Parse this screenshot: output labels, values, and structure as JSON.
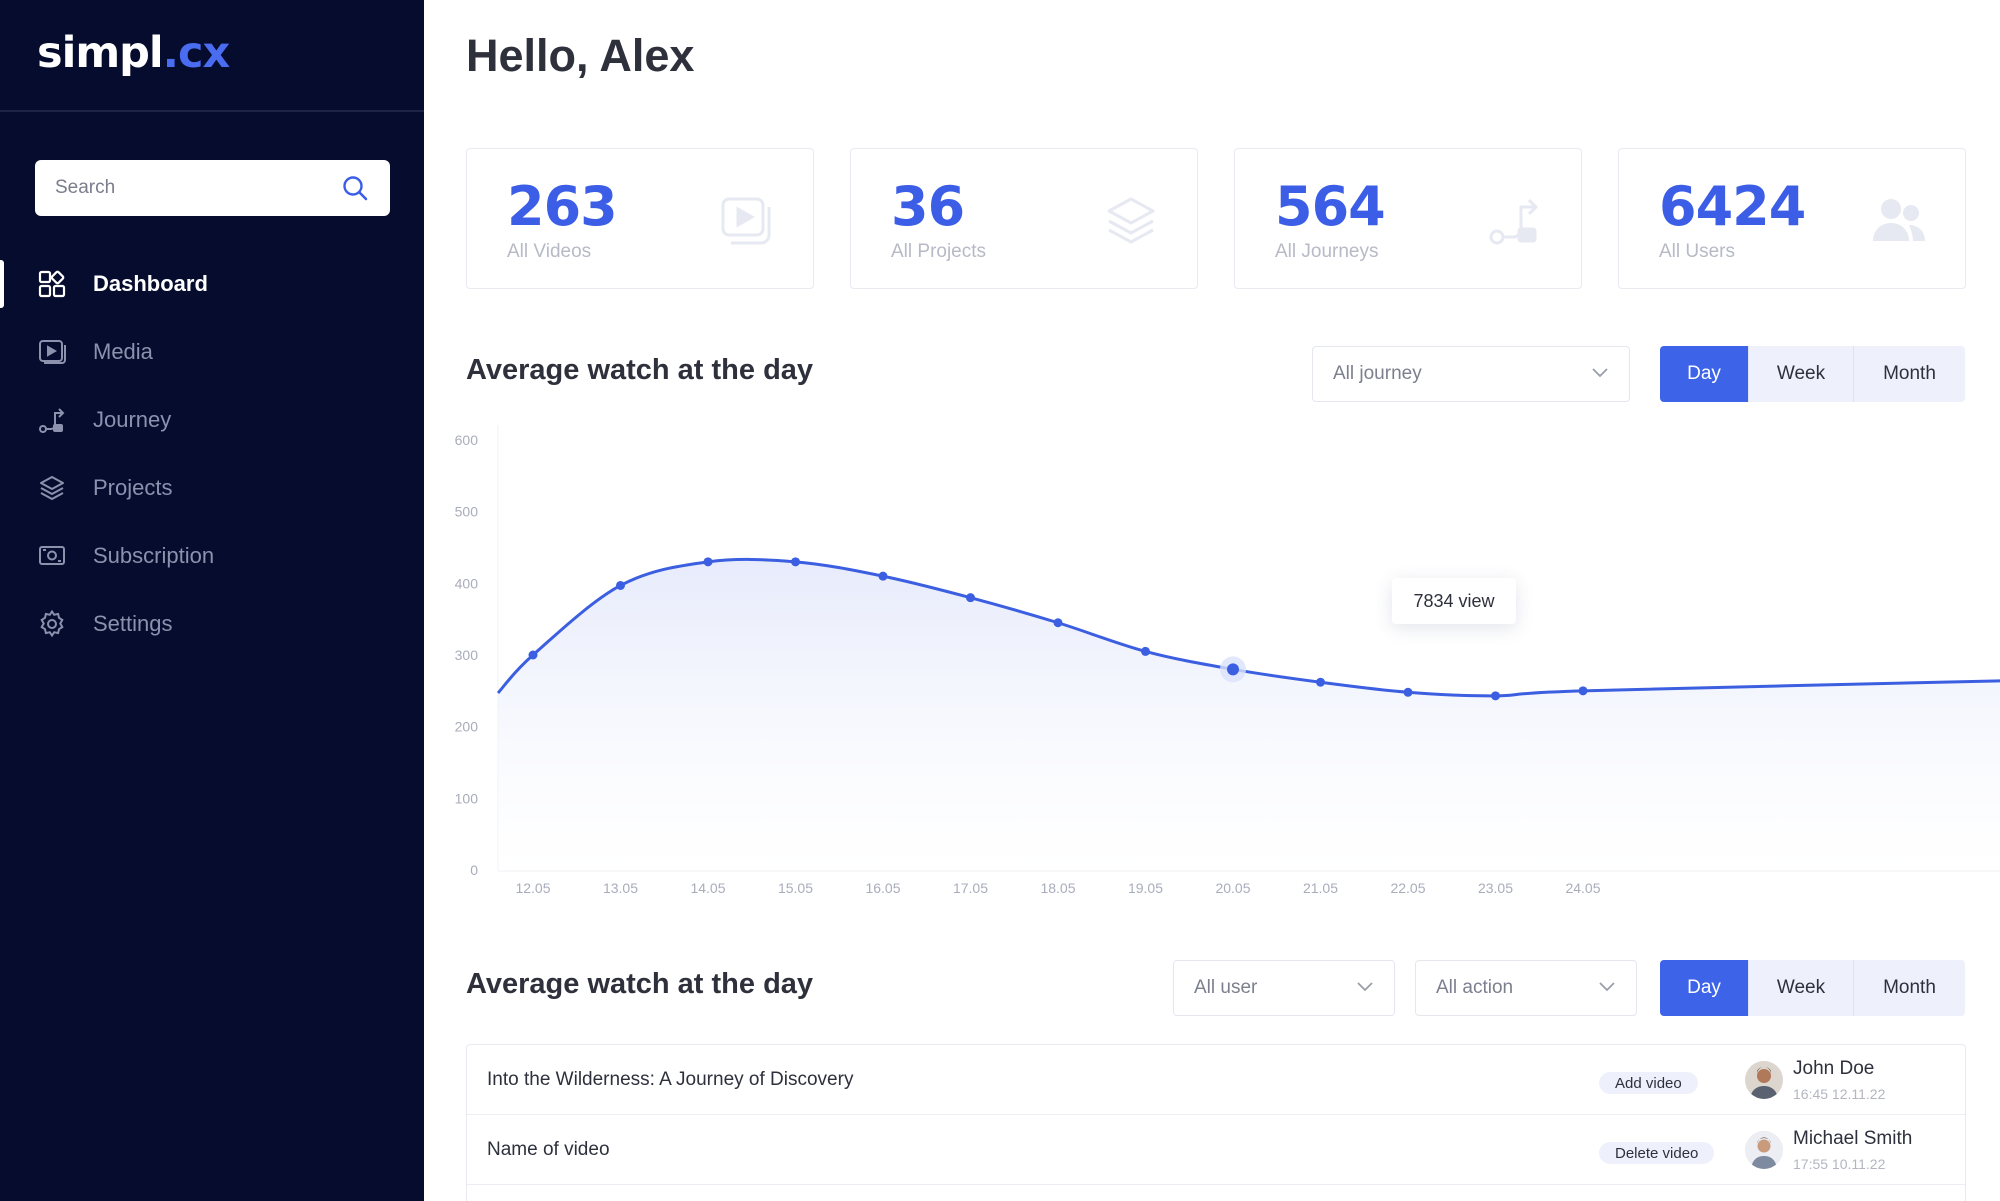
{
  "brand": {
    "name": "simpl",
    "accent": ".cx"
  },
  "search": {
    "placeholder": "Search"
  },
  "nav": [
    {
      "label": "Dashboard",
      "icon": "dashboard-icon",
      "active": true
    },
    {
      "label": "Media",
      "icon": "media-icon"
    },
    {
      "label": "Journey",
      "icon": "journey-icon"
    },
    {
      "label": "Projects",
      "icon": "projects-icon"
    },
    {
      "label": "Subscription",
      "icon": "subscription-icon"
    },
    {
      "label": "Settings",
      "icon": "gear-icon"
    }
  ],
  "greeting": "Hello, Alex",
  "stats": [
    {
      "value": "263",
      "label": "All Videos",
      "icon": "video-icon"
    },
    {
      "value": "36",
      "label": "All Projects",
      "icon": "layers-icon"
    },
    {
      "value": "564",
      "label": "All Journeys",
      "icon": "journey-icon"
    },
    {
      "value": "6424",
      "label": "All Users",
      "icon": "users-icon"
    }
  ],
  "chart_section": {
    "title": "Average watch at the day",
    "filter": "All journey",
    "periods": [
      "Day",
      "Week",
      "Month"
    ],
    "active_period": "Day"
  },
  "chart_data": {
    "type": "area",
    "title": "",
    "xlabel": "",
    "ylabel": "",
    "x": [
      "12.05",
      "13.05",
      "14.05",
      "15.05",
      "16.05",
      "17.05",
      "18.05",
      "19.05",
      "20.05",
      "21.05",
      "22.05",
      "23.05",
      "24.05"
    ],
    "series": [
      {
        "values": [
          300,
          397,
          430,
          430,
          410,
          380,
          345,
          305,
          280,
          262,
          248,
          243,
          250
        ]
      }
    ],
    "ylim": [
      0,
      600
    ],
    "yticks": [
      0,
      100,
      200,
      300,
      400,
      500,
      600
    ],
    "grid": false,
    "tooltip": {
      "x": "20.05",
      "text": "7834 view"
    },
    "colors": {
      "line": "#3b5fe0",
      "fill_top": "#e4e9fb"
    }
  },
  "activity_section": {
    "title": "Average watch at the day",
    "filter_user": "All user",
    "filter_action": "All action",
    "periods": [
      "Day",
      "Week",
      "Month"
    ],
    "active_period": "Day"
  },
  "activity": [
    {
      "title": "Into the Wilderness: A Journey of Discovery",
      "action": "Add video",
      "user": "John Doe",
      "time": "16:45 12.11.22"
    },
    {
      "title": "Name of video",
      "action": "Delete video",
      "user": "Michael Smith",
      "time": "17:55 10.11.22"
    }
  ],
  "colors": {
    "sidebar": "#060c2e",
    "accent": "#3c63e8"
  }
}
